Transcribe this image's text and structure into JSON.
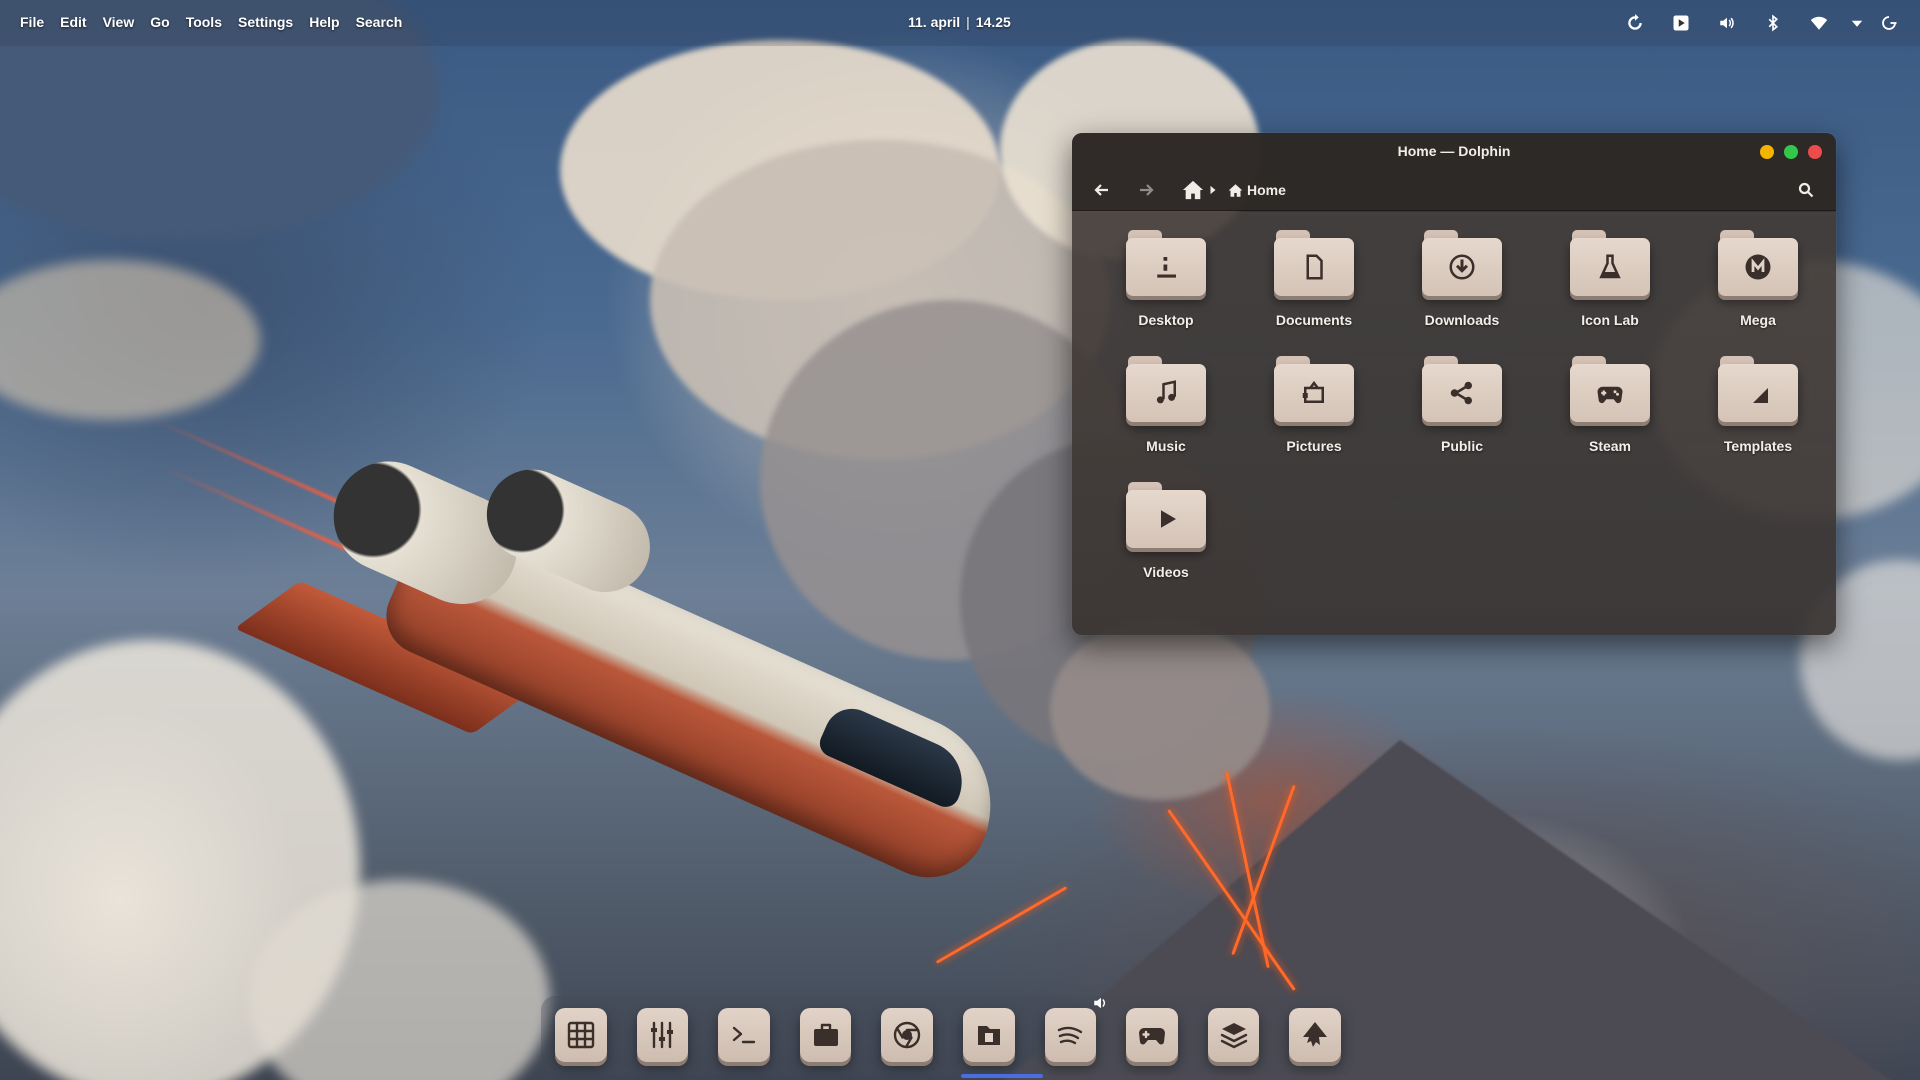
{
  "menubar": {
    "items": [
      "File",
      "Edit",
      "View",
      "Go",
      "Tools",
      "Settings",
      "Help",
      "Search"
    ]
  },
  "clock": {
    "date": "11. april",
    "time": "14.25"
  },
  "tray": {
    "icons": [
      "refresh-sync-icon",
      "media-play-icon",
      "volume-icon",
      "bluetooth-icon",
      "wifi-icon",
      "dropdown-arrow-icon",
      "power-icon"
    ]
  },
  "window": {
    "title": "Home — Dolphin",
    "controls": {
      "minimize_color": "#f4b400",
      "maximize_color": "#34c84a",
      "close_color": "#ee4b4b"
    },
    "breadcrumb": {
      "label": "Home"
    },
    "items": [
      {
        "label": "Desktop",
        "icon": "desktop-icon"
      },
      {
        "label": "Documents",
        "icon": "document-icon"
      },
      {
        "label": "Downloads",
        "icon": "download-icon"
      },
      {
        "label": "Icon Lab",
        "icon": "flask-icon"
      },
      {
        "label": "Mega",
        "icon": "mega-icon"
      },
      {
        "label": "Music",
        "icon": "music-note-icon"
      },
      {
        "label": "Pictures",
        "icon": "picture-icon"
      },
      {
        "label": "Public",
        "icon": "share-icon"
      },
      {
        "label": "Steam",
        "icon": "gamepad-icon"
      },
      {
        "label": "Templates",
        "icon": "template-icon"
      },
      {
        "label": "Videos",
        "icon": "play-icon"
      }
    ]
  },
  "dock": {
    "items": [
      "app-grid-icon",
      "mixer-icon",
      "terminal-icon",
      "briefcase-icon",
      "browser-icon",
      "files-icon",
      "spotify-icon",
      "gamepad-icon",
      "layers-icon",
      "inkscape-icon"
    ],
    "active_item": "files-icon",
    "accent": "#4a6de0"
  }
}
